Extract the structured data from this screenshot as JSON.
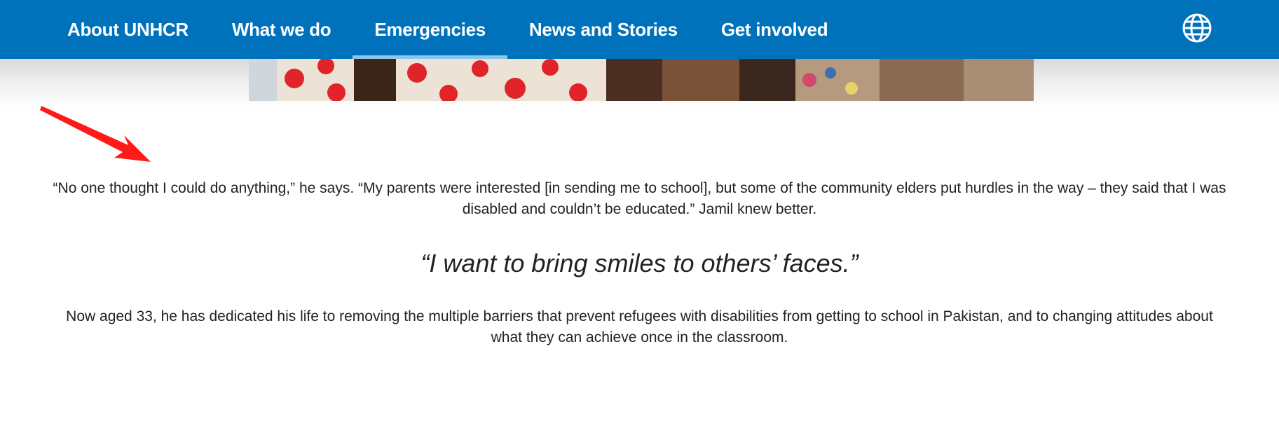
{
  "nav": {
    "items": [
      {
        "label": "About UNHCR",
        "active": false
      },
      {
        "label": "What we do",
        "active": false
      },
      {
        "label": "Emergencies",
        "active": true
      },
      {
        "label": "News and Stories",
        "active": false
      },
      {
        "label": "Get involved",
        "active": false
      }
    ],
    "language_icon": "globe-icon",
    "background_color": "#0072bc",
    "active_indicator_color": "#8ec5ea"
  },
  "annotation": {
    "icon": "arrow-icon",
    "color": "#ff1a1a"
  },
  "article": {
    "paragraph_1": "“No one thought I could do anything,” he says. “My parents were interested [in sending me to school], but some of the community elders put hurdles in the way – they said that I was disabled and couldn’t be educated.” Jamil knew better.",
    "pull_quote": "“I want to bring smiles to others’ faces.”",
    "paragraph_2": "Now aged 33, he has dedicated his life to removing the multiple barriers that prevent refugees with disabilities from getting to school in Pakistan, and to changing attitudes about what they can achieve once in the classroom."
  }
}
